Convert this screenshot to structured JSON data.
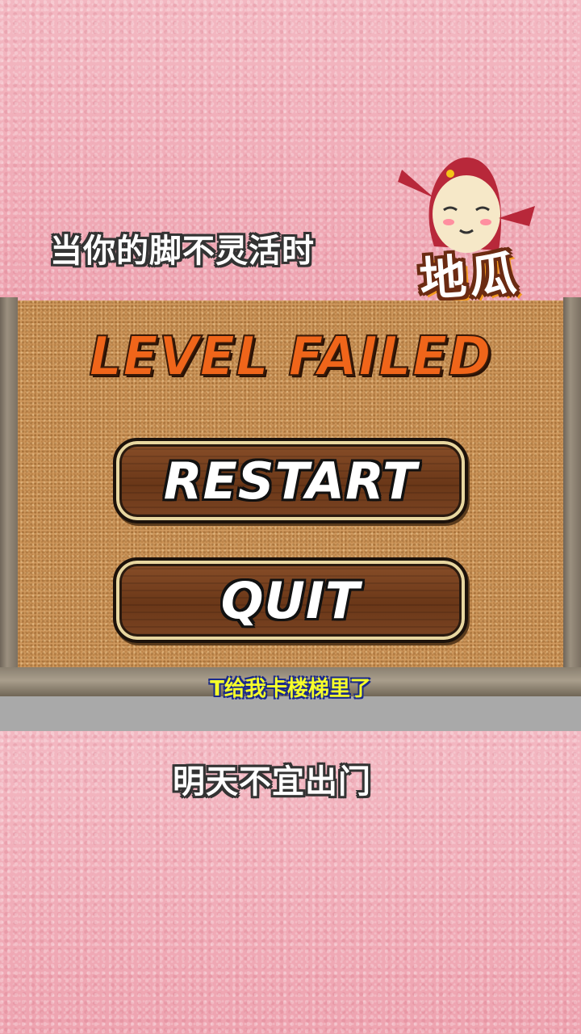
{
  "captions": {
    "top": "当你的脚不灵活时",
    "bottom": "明天不宜出门",
    "subtitle": "T给我卡楼梯里了"
  },
  "logo": {
    "text": "地瓜",
    "icon": "sweet-potato-mascot-icon"
  },
  "game": {
    "title": "LEVEL FAILED",
    "buttons": {
      "restart": "RESTART",
      "quit": "QUIT"
    }
  },
  "colors": {
    "background_pink": "#f0aab6",
    "cork": "#d09a5f",
    "title_orange": "#f0651a",
    "subtitle_yellow": "#f6ff2a"
  }
}
